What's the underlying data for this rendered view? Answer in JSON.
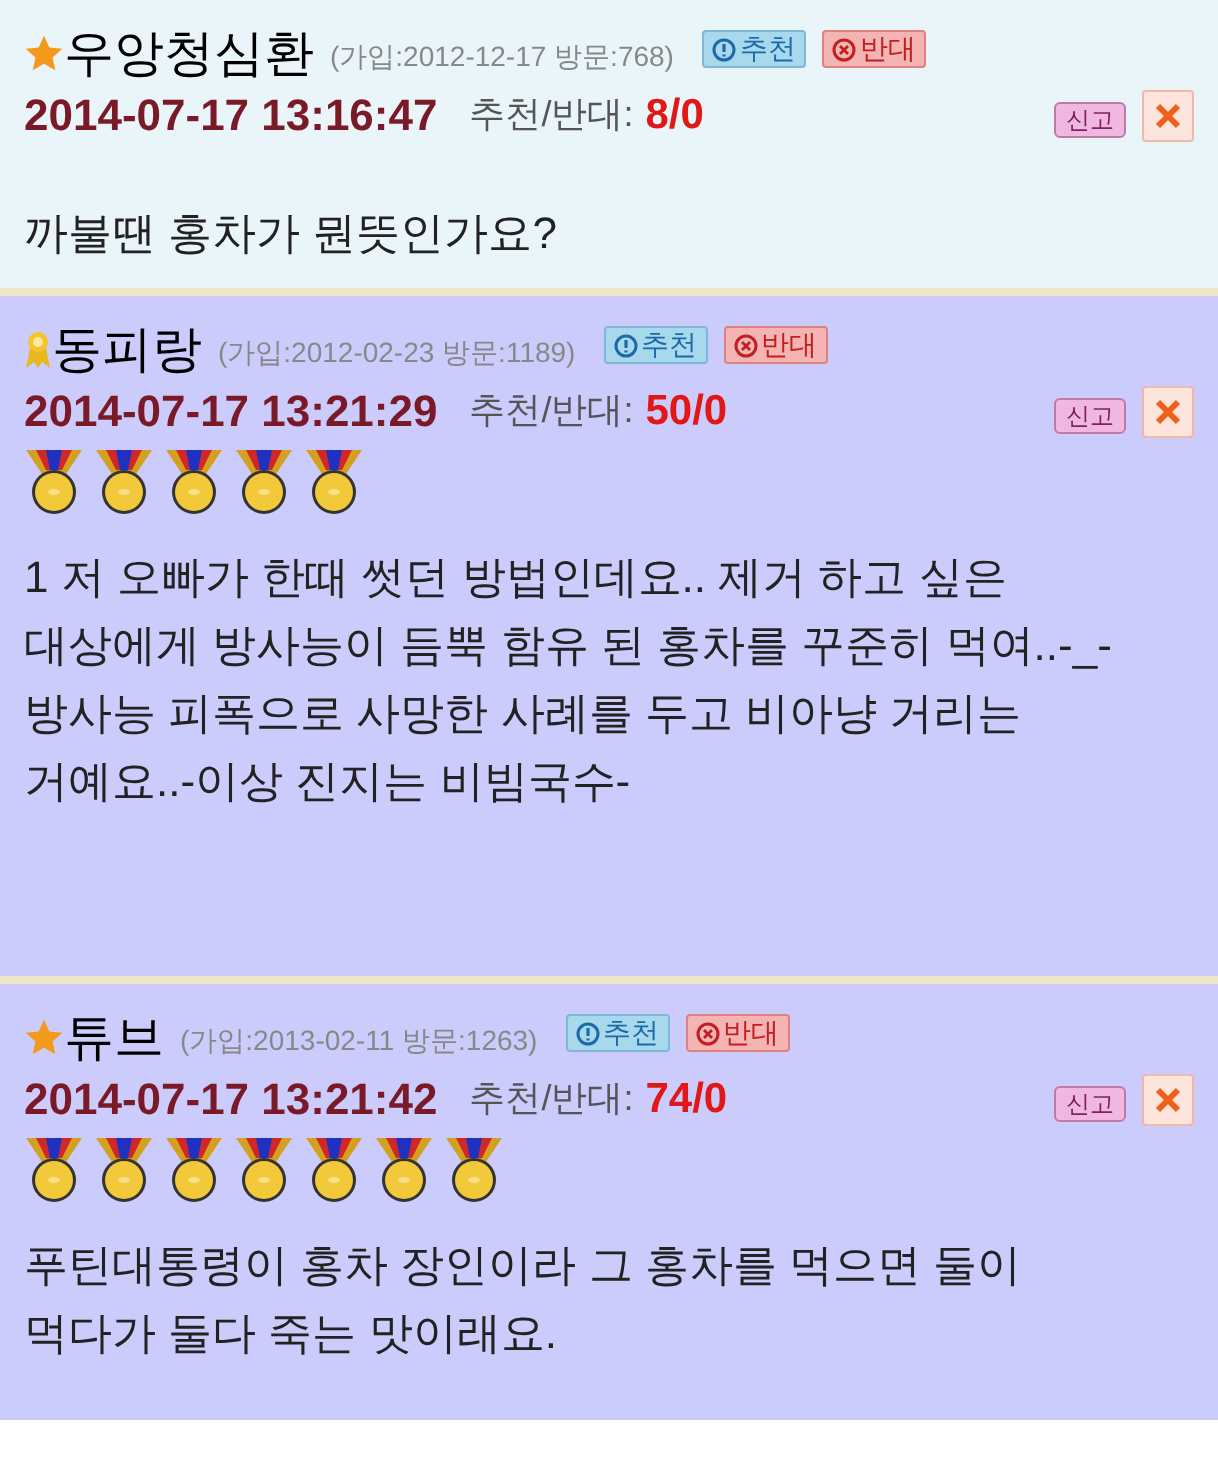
{
  "posts": [
    {
      "kind": "original",
      "user": {
        "kind": "star",
        "nickname": "우앙청심환"
      },
      "member_info": "(가입:2012-12-17 방문:768)",
      "recommend_button": "추천",
      "oppose_button": "반대",
      "datetime": "2014-07-17 13:16:47",
      "vote_label": "추천/반대:",
      "vote_count": "8/0",
      "report_button": "신고",
      "paragraphs": [
        "까불땐 홍차가 뭔뜻인가요?"
      ]
    },
    {
      "kind": "reply",
      "user": {
        "kind": "ribbon",
        "nickname": "동피랑"
      },
      "member_info": "(가입:2012-02-23 방문:1189)",
      "recommend_button": "추천",
      "oppose_button": "반대",
      "datetime": "2014-07-17 13:21:29",
      "vote_label": "추천/반대:",
      "vote_count": "50/0",
      "report_button": "신고",
      "stars": 5,
      "paragraphs": [
        "1 저 오빠가 한때 썻던 방법인데요.. 제거 하고 싶은 대상에게 방사능이 듬뿍 함유 된 홍차를 꾸준히 먹여..-_-",
        "방사능 피폭으로 사망한 사례를 두고 비아냥 거리는 거예요..-이상 진지는 비빔국수-"
      ]
    },
    {
      "kind": "reply",
      "user": {
        "kind": "star",
        "nickname": "튜브"
      },
      "member_info": "(가입:2013-02-11 방문:1263)",
      "recommend_button": "추천",
      "oppose_button": "반대",
      "datetime": "2014-07-17 13:21:42",
      "vote_label": "추천/반대:",
      "vote_count": "74/0",
      "report_button": "신고",
      "stars": 7,
      "paragraphs": [
        "푸틴대통령이 홍차 장인이라 그 홍차를 먹으면 둘이 먹다가 둘다 죽는 맛이래요."
      ]
    }
  ]
}
